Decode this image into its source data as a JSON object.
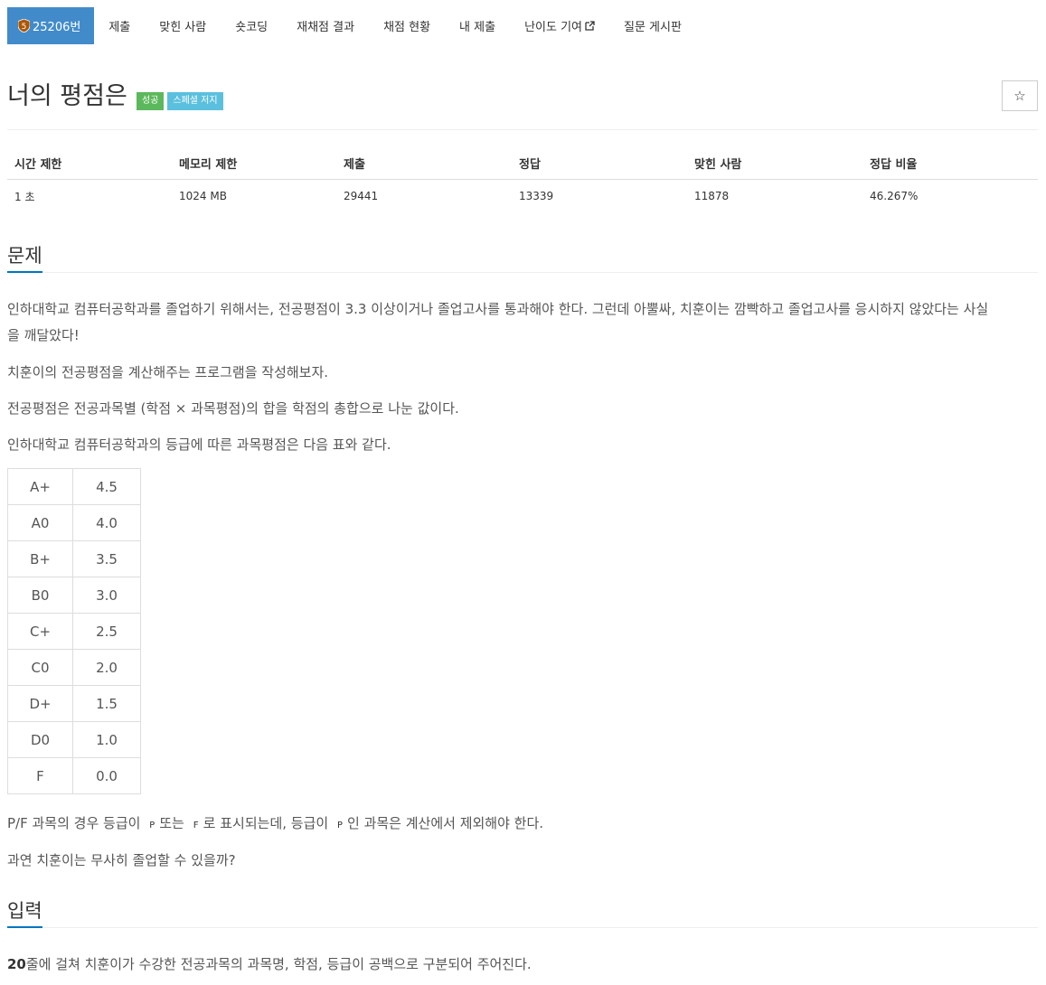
{
  "nav": {
    "problem_id": "25206번",
    "items": [
      {
        "label": "제출"
      },
      {
        "label": "맞힌 사람"
      },
      {
        "label": "숏코딩"
      },
      {
        "label": "재채점 결과"
      },
      {
        "label": "채점 현황"
      },
      {
        "label": "내 제출"
      },
      {
        "label": "난이도 기여"
      },
      {
        "label": "질문 게시판"
      }
    ],
    "tier_badge_number": "5"
  },
  "problem": {
    "title": "너의 평점은",
    "badges": [
      "성공",
      "스페셜 저지"
    ],
    "star_glyph": "☆"
  },
  "stats": {
    "headers": [
      "시간 제한",
      "메모리 제한",
      "제출",
      "정답",
      "맞힌 사람",
      "정답 비율"
    ],
    "values": [
      "1 초",
      "1024 MB",
      "29441",
      "13339",
      "11878",
      "46.267%"
    ]
  },
  "sections": {
    "problem": "문제",
    "input": "입력"
  },
  "description": {
    "p1a": "인하대학교 컴퓨터공학과를 졸업하기 위해서는, 전공평점이 3.3 이상이거나 졸업고사를 통과해야 한다. 그런데 아뿔싸, 치훈이는 깜빡하고 졸업고사를 응시하지 않았다는 사실",
    "p1b": "을 깨달았다!",
    "p2": "치훈이의 전공평점을 계산해주는 프로그램을 작성해보자.",
    "p3": "전공평점은 전공과목별 (학점 × 과목평점)의 합을 학점의 총합으로 나눈 값이다.",
    "p4": "인하대학교 컴퓨터공학과의 등급에 따른 과목평점은 다음 표와 같다.",
    "p5_a": "P/F 과목의 경우 등급이",
    "p5_code1": "P",
    "p5_b": "또는",
    "p5_code2": "F",
    "p5_c": "로 표시되는데, 등급이",
    "p5_code3": "P",
    "p5_d": "인 과목은 계산에서 제외해야 한다.",
    "p6": "과연 치훈이는 무사히 졸업할 수 있을까?"
  },
  "grade_table": [
    {
      "grade": "A+",
      "point": "4.5"
    },
    {
      "grade": "A0",
      "point": "4.0"
    },
    {
      "grade": "B+",
      "point": "3.5"
    },
    {
      "grade": "B0",
      "point": "3.0"
    },
    {
      "grade": "C+",
      "point": "2.5"
    },
    {
      "grade": "C0",
      "point": "2.0"
    },
    {
      "grade": "D+",
      "point": "1.5"
    },
    {
      "grade": "D0",
      "point": "1.0"
    },
    {
      "grade": "F",
      "point": "0.0"
    }
  ],
  "input_desc": {
    "bold": "20",
    "rest": "줄에 걸쳐 치훈이가 수강한 전공과목의 과목명, 학점, 등급이 공백으로 구분되어 주어진다."
  },
  "colors": {
    "nav_active": "#428bca",
    "success": "#5cb85c",
    "info": "#5bc0de",
    "section_underline": "#0076c0"
  }
}
